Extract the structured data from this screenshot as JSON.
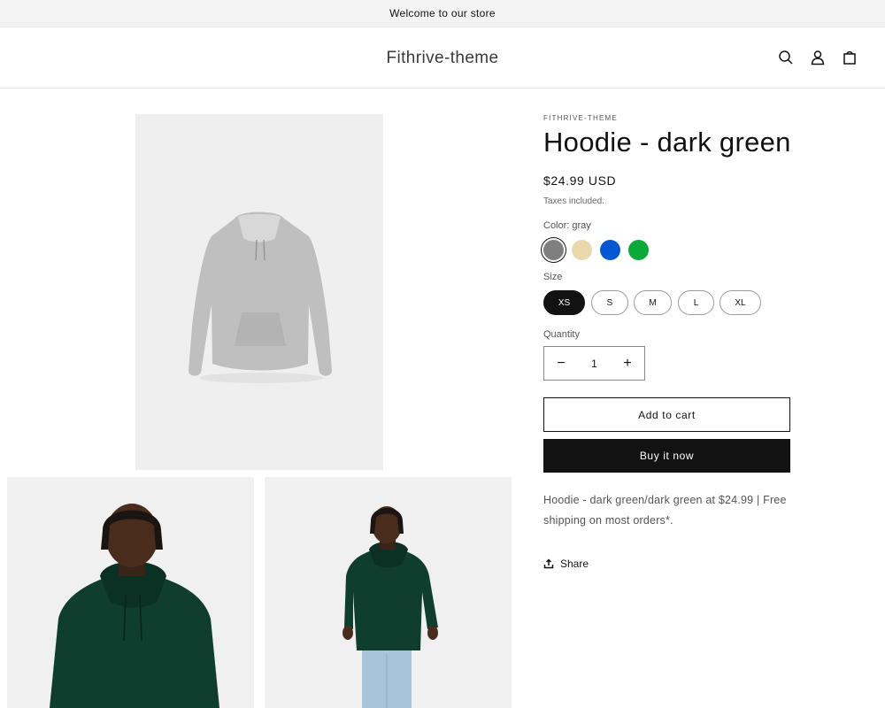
{
  "announcement": {
    "text": "Welcome to our store"
  },
  "header": {
    "logo": "Fithrive-theme",
    "icons": [
      "search-icon",
      "account-icon",
      "cart-icon"
    ]
  },
  "gallery": {
    "images": [
      "gray-hoodie-product",
      "model-green-hoodie-closeup",
      "model-green-hoodie-full"
    ]
  },
  "product": {
    "vendor": "FITHRIVE-THEME",
    "title": "Hoodie - dark green",
    "price": "$24.99 USD",
    "tax_note": "Taxes included.",
    "color_label": "Color: gray",
    "colors": [
      {
        "name": "gray",
        "hex": "#7f7f7f",
        "selected": true
      },
      {
        "name": "beige",
        "hex": "#ead8ad",
        "selected": false
      },
      {
        "name": "blue",
        "hex": "#0457d2",
        "selected": false
      },
      {
        "name": "green",
        "hex": "#0aaa3a",
        "selected": false
      }
    ],
    "size_label": "Size",
    "sizes": [
      "XS",
      "S",
      "M",
      "L",
      "XL"
    ],
    "selected_size": "XS",
    "quantity_label": "Quantity",
    "quantity": "1",
    "qty_minus": "−",
    "qty_plus": "+",
    "add_to_cart": "Add to cart",
    "buy_now": "Buy it now",
    "description": "Hoodie - dark green/dark green at $24.99 | Free shipping on most orders*.",
    "share": "Share"
  },
  "colors": {
    "announcement_bg": "#f3f3f3",
    "button_dark": "#121212",
    "hoodie_green": "#0f3d2e"
  }
}
